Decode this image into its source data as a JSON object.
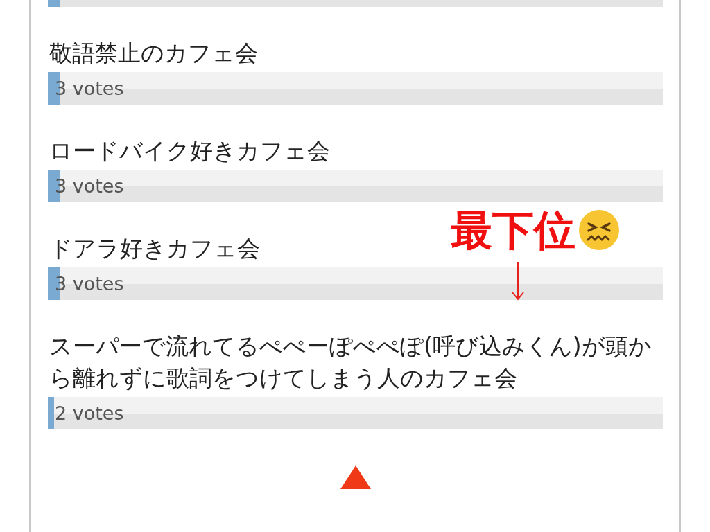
{
  "poll_options": [
    {
      "level": 0.02
    },
    {
      "title": "敬語禁止のカフェ会",
      "votes": "3 votes",
      "level": 0.02
    },
    {
      "title": "ロードバイク好きカフェ会",
      "votes": "3 votes",
      "level": 0.02
    },
    {
      "title": "ドアラ好きカフェ会",
      "votes": "3 votes",
      "level": 0.02
    },
    {
      "title": "スーパーで流れてるぺぺーぽぺぺぽ(呼び込みくん)が頭から離れずに歌詞をつけてしまう人のカフェ会",
      "votes": "2 votes",
      "level": 0.01
    }
  ],
  "annotation": {
    "text": "最下位"
  }
}
